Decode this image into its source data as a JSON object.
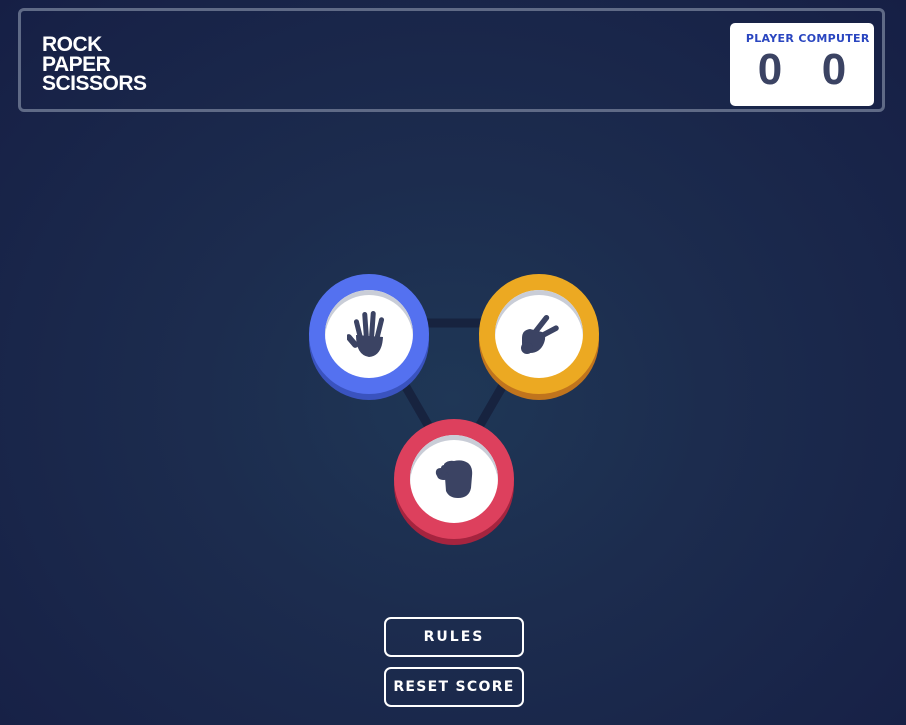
{
  "header": {
    "title_lines": [
      "ROCK",
      "PAPER",
      "SCISSORS"
    ]
  },
  "scoreboard": {
    "player_label": "PLAYER",
    "player_score": "0",
    "computer_label": "COMPUTER",
    "computer_score": "0"
  },
  "choices": [
    {
      "name": "paper",
      "icon": "open-hand-icon",
      "ring_color": "#5471f0"
    },
    {
      "name": "scissors",
      "icon": "scissors-hand-icon",
      "ring_color": "#eca922"
    },
    {
      "name": "rock",
      "icon": "fist-icon",
      "ring_color": "#dd405d"
    }
  ],
  "buttons": {
    "rules_label": "RULES",
    "reset_label": "RESET SCORE"
  },
  "colors": {
    "icon": "#3b4363",
    "background": "#1c2c4e"
  }
}
